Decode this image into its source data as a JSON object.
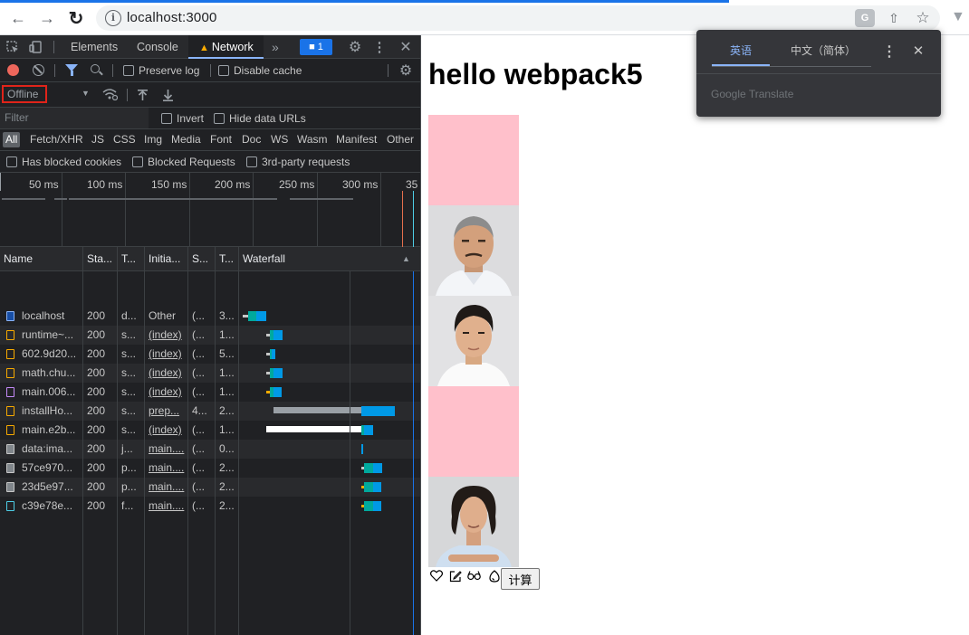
{
  "browser": {
    "url": "localhost:3000",
    "icons": [
      "back-arrow-icon",
      "forward-arrow-icon",
      "reload-icon",
      "info-icon",
      "translate-icon",
      "share-icon",
      "star-icon",
      "extension-icon"
    ]
  },
  "devtools": {
    "tabs": [
      "Elements",
      "Console",
      "Network"
    ],
    "active_tab": "Network",
    "issues_count": "1",
    "preserve_log_label": "Preserve log",
    "disable_cache_label": "Disable cache",
    "throttle_value": "Offline",
    "filter_placeholder": "Filter",
    "invert_label": "Invert",
    "hide_data_urls_label": "Hide data URLs",
    "resource_types": [
      "All",
      "Fetch/XHR",
      "JS",
      "CSS",
      "Img",
      "Media",
      "Font",
      "Doc",
      "WS",
      "Wasm",
      "Manifest",
      "Other"
    ],
    "blocked_filters": [
      "Has blocked cookies",
      "Blocked Requests",
      "3rd-party requests"
    ],
    "overview_ticks": [
      "50 ms",
      "100 ms",
      "150 ms",
      "200 ms",
      "250 ms",
      "300 ms",
      "35"
    ],
    "columns": [
      "Name",
      "Sta...",
      "T...",
      "Initia...",
      "S...",
      "T...",
      "Waterfall"
    ],
    "requests": [
      {
        "icon": "doc",
        "name": "localhost",
        "status": "200",
        "type": "d...",
        "initiator": "Other",
        "initiator_link": false,
        "size": "(...",
        "time": "3..."
      },
      {
        "icon": "script",
        "name": "runtime~...",
        "status": "200",
        "type": "s...",
        "initiator": "(index)",
        "initiator_link": true,
        "size": "(...",
        "time": "1..."
      },
      {
        "icon": "script",
        "name": "602.9d20...",
        "status": "200",
        "type": "s...",
        "initiator": "(index)",
        "initiator_link": true,
        "size": "(...",
        "time": "5..."
      },
      {
        "icon": "script",
        "name": "math.chu...",
        "status": "200",
        "type": "s...",
        "initiator": "(index)",
        "initiator_link": true,
        "size": "(...",
        "time": "1..."
      },
      {
        "icon": "style",
        "name": "main.006...",
        "status": "200",
        "type": "s...",
        "initiator": "(index)",
        "initiator_link": true,
        "size": "(...",
        "time": "1..."
      },
      {
        "icon": "script",
        "name": "installHo...",
        "status": "200",
        "type": "s...",
        "initiator": "prep...",
        "initiator_link": true,
        "size": "4...",
        "time": "2..."
      },
      {
        "icon": "script",
        "name": "main.e2b...",
        "status": "200",
        "type": "s...",
        "initiator": "(index)",
        "initiator_link": true,
        "size": "(...",
        "time": "1..."
      },
      {
        "icon": "img",
        "name": "data:ima...",
        "status": "200",
        "type": "j...",
        "initiator": "main....",
        "initiator_link": true,
        "size": "(...",
        "time": "0..."
      },
      {
        "icon": "img",
        "name": "57ce970...",
        "status": "200",
        "type": "p...",
        "initiator": "main....",
        "initiator_link": true,
        "size": "(...",
        "time": "2..."
      },
      {
        "icon": "img",
        "name": "23d5e97...",
        "status": "200",
        "type": "p...",
        "initiator": "main....",
        "initiator_link": true,
        "size": "(...",
        "time": "2..."
      },
      {
        "icon": "font",
        "name": "c39e78e...",
        "status": "200",
        "type": "f...",
        "initiator": "main....",
        "initiator_link": true,
        "size": "(...",
        "time": "2..."
      }
    ]
  },
  "page": {
    "heading": "hello webpack5",
    "blocks": [
      "pink-box",
      "photo-bald-man",
      "photo-young-man",
      "pink-box",
      "photo-curly-hair-man"
    ],
    "icon_names": [
      "heart-icon",
      "edit-icon",
      "glasses-icon",
      "egg-icon"
    ],
    "button_label": "计算"
  },
  "translate_popup": {
    "tabs": [
      "英语",
      "中文（简体）"
    ],
    "active_tab": "英语",
    "brand": "Google Translate"
  },
  "colors": {
    "devtools_bg": "#202124",
    "accent_blue": "#8ab4f8",
    "record_red": "#ee675c",
    "highlight_red": "#e0241a",
    "pink_block": "#ffc0cb",
    "waterfall_waiting": "#00a99d",
    "waterfall_download": "#0099e6"
  }
}
